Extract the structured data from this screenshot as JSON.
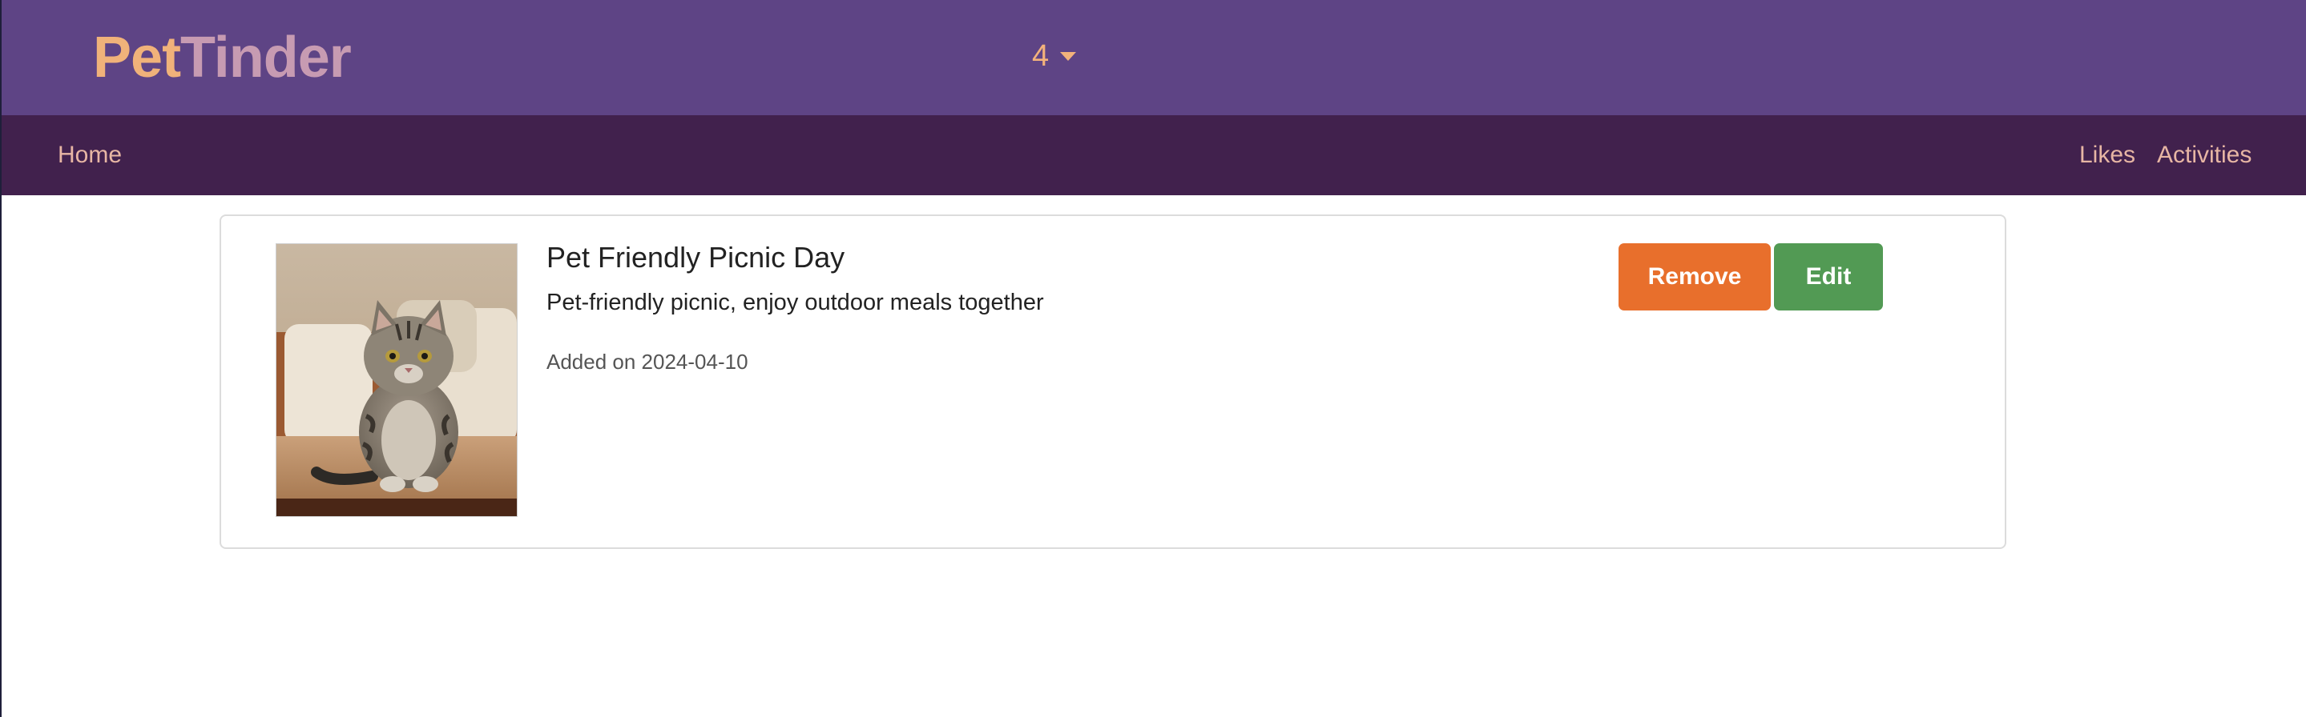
{
  "header": {
    "logo_part1": "Pet",
    "logo_part2": "Tinder",
    "selector_value": "4"
  },
  "nav": {
    "home": "Home",
    "likes": "Likes",
    "activities": "Activities"
  },
  "activity": {
    "title": "Pet Friendly Picnic Day",
    "description": "Pet-friendly picnic, enjoy outdoor meals together",
    "added_date": "Added on 2024-04-10",
    "remove_label": "Remove",
    "edit_label": "Edit"
  },
  "colors": {
    "header_bg": "#5e4485",
    "nav_bg": "#41214d",
    "accent": "#f0b27a",
    "remove_button": "#e86f2c",
    "edit_button": "#529a54"
  }
}
